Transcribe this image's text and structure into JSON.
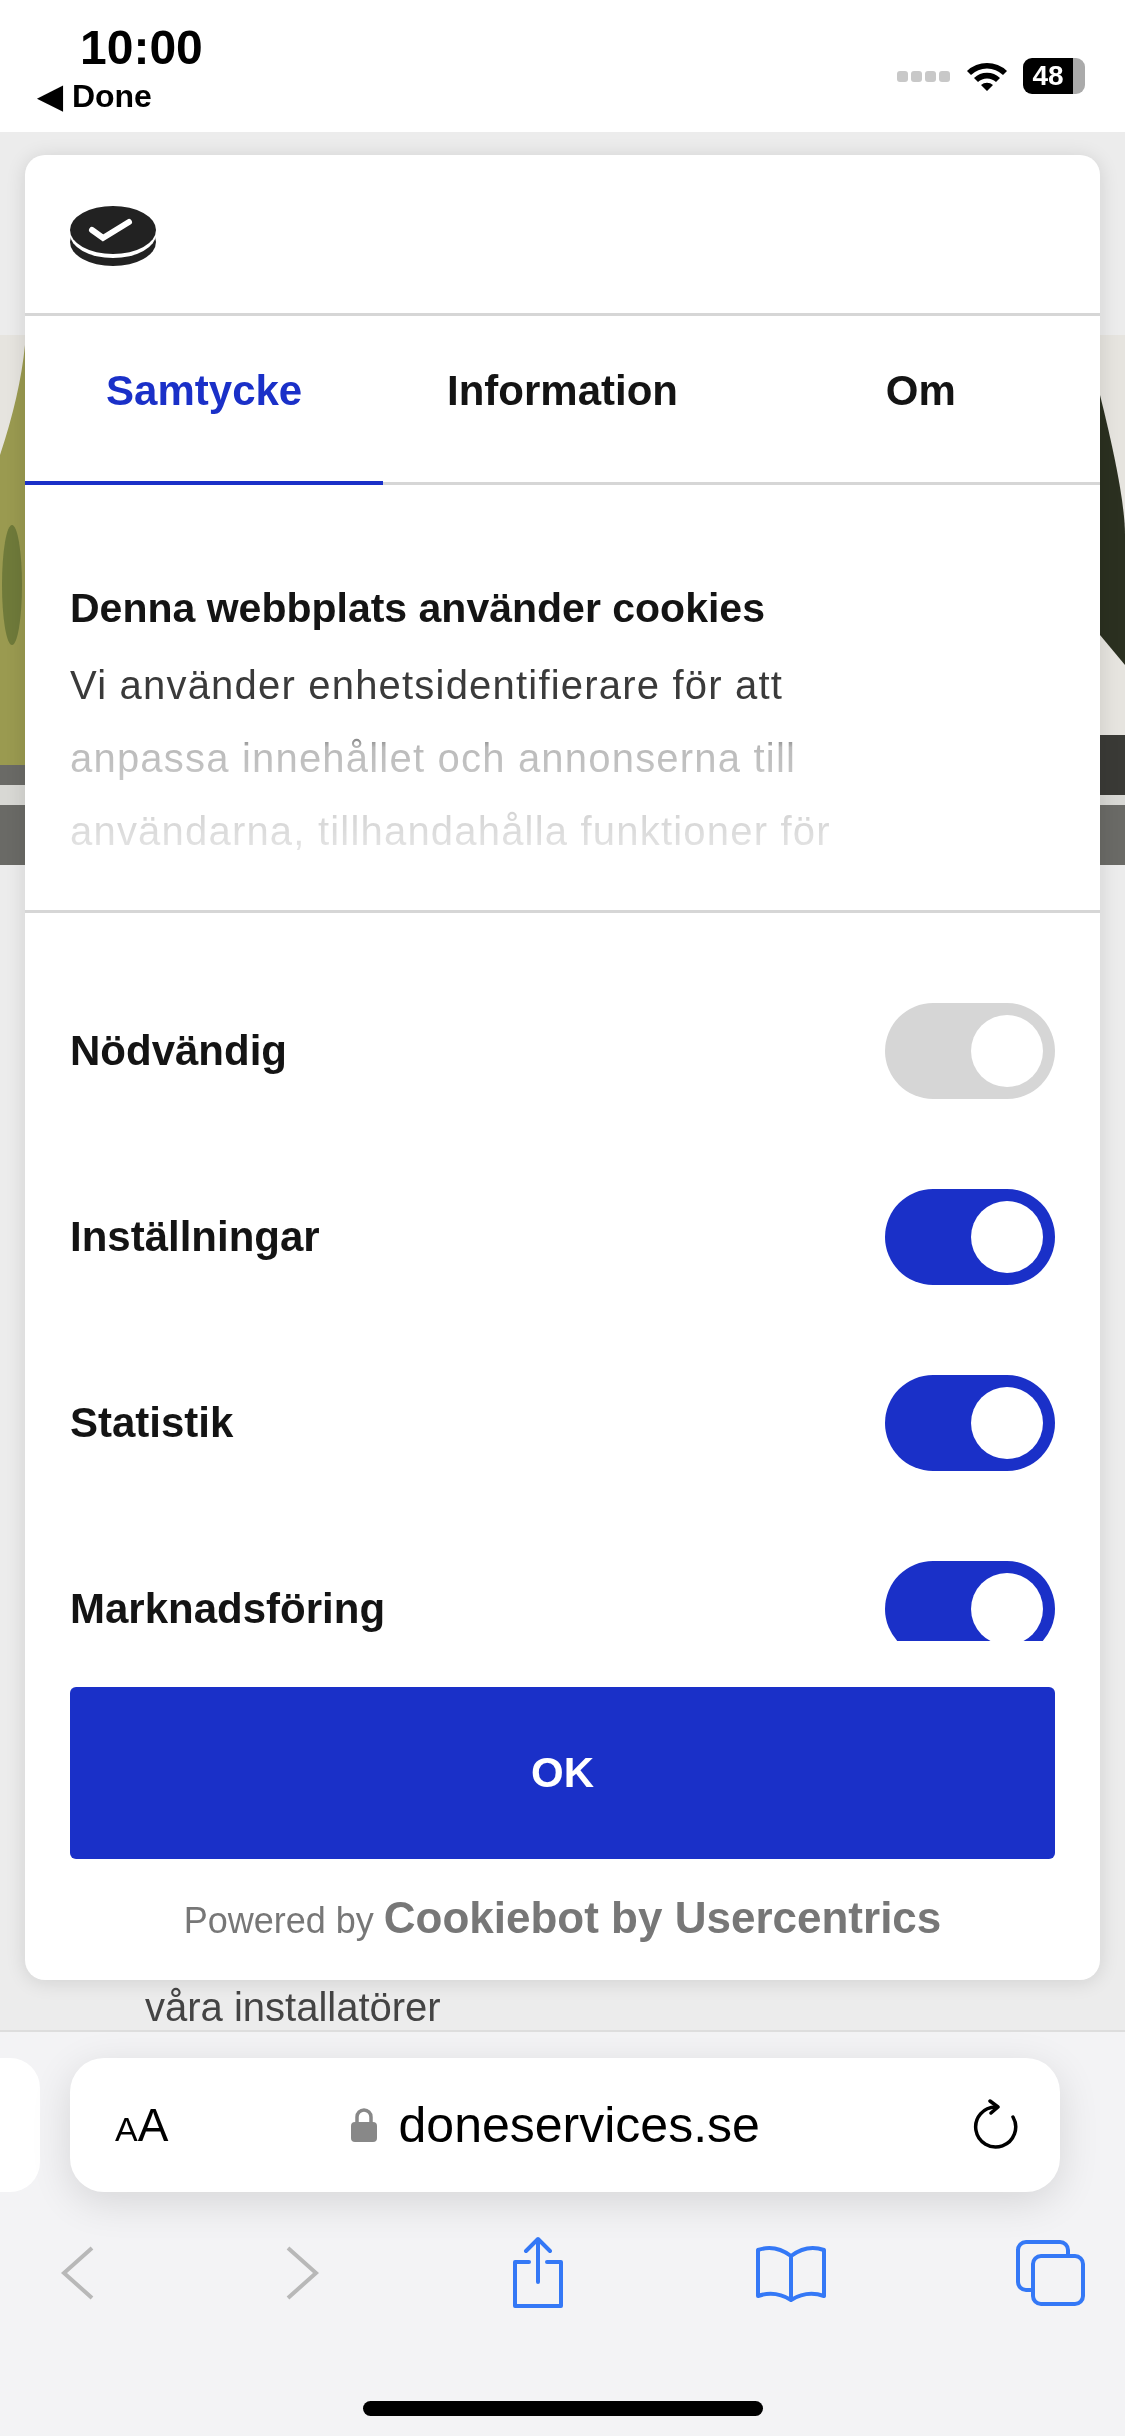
{
  "status_bar": {
    "time": "10:00",
    "back_label": "◀ Done",
    "battery": "48"
  },
  "dialog": {
    "tabs": [
      {
        "label": "Samtycke",
        "selected": true
      },
      {
        "label": "Information",
        "selected": false
      },
      {
        "label": "Om",
        "selected": false
      }
    ],
    "heading": "Denna webbplats använder cookies",
    "body": "Vi använder enhetsidentifierare för att anpassa innehållet och annonserna till användarna, tillhandahålla funktioner för",
    "toggles": [
      {
        "label": "Nödvändig",
        "on": true,
        "disabled": true
      },
      {
        "label": "Inställningar",
        "on": true,
        "disabled": false
      },
      {
        "label": "Statistik",
        "on": true,
        "disabled": false
      },
      {
        "label": "Marknadsföring",
        "on": true,
        "disabled": false
      }
    ],
    "ok_button": "OK",
    "powered_by": "Powered by **Cookiebot by Usercentrics**"
  },
  "page_text": "våra installatörer",
  "browser": {
    "text_size": "AA",
    "url": "doneservices.se",
    "back_disabled": true,
    "forward_disabled": true
  }
}
